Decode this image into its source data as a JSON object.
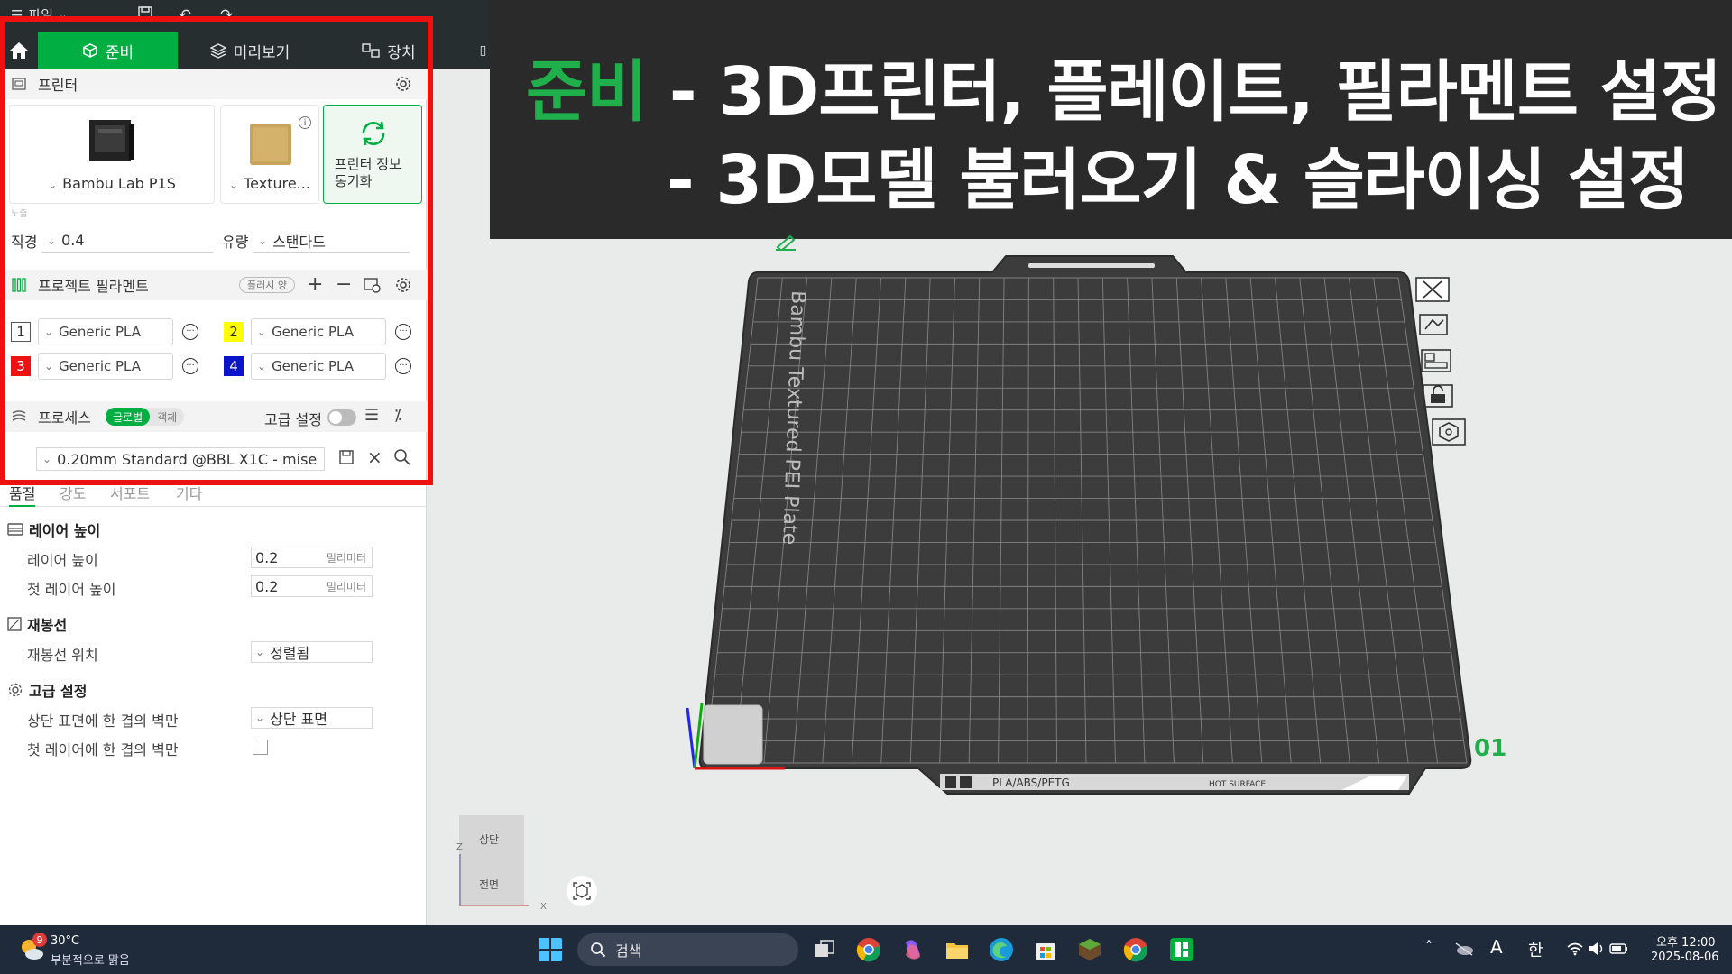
{
  "menu": {
    "file_label": "파일"
  },
  "tabs": [
    {
      "label": "준비"
    },
    {
      "label": "미리보기"
    },
    {
      "label": "장치"
    }
  ],
  "printer": {
    "section_title": "프린터",
    "printer_name": "Bambu Lab P1S",
    "plate_name": "Texture...",
    "sync_label_1": "프린터 정보",
    "sync_label_2": "동기화",
    "nozzle_section": "노즐",
    "diameter_label": "직경",
    "diameter_value": "0.4",
    "flow_label": "유량",
    "flow_value": "스탠다드"
  },
  "filament": {
    "section_title": "프로젝트 필라멘트",
    "flush_label": "플러시 양",
    "items": [
      {
        "num": "1",
        "name": "Generic PLA",
        "color": "#ffffff"
      },
      {
        "num": "2",
        "name": "Generic PLA",
        "color": "#ffff00"
      },
      {
        "num": "3",
        "name": "Generic PLA",
        "color": "#ee1111"
      },
      {
        "num": "4",
        "name": "Generic PLA",
        "color": "#0a14c8"
      }
    ]
  },
  "process": {
    "section_title": "프로세스",
    "global_label": "글로벌",
    "object_label": "객체",
    "advanced_label": "고급 설정",
    "preset": "0.20mm Standard @BBL X1C - mise"
  },
  "subtabs": [
    "품질",
    "강도",
    "서포트",
    "기타"
  ],
  "quality": {
    "layer_group": "레이어 높이",
    "layer_height_label": "레이어 높이",
    "layer_height_value": "0.2",
    "first_layer_label": "첫 레이어 높이",
    "first_layer_value": "0.2",
    "unit": "밀리미터",
    "seam_group": "재봉선",
    "seam_pos_label": "재봉선 위치",
    "seam_pos_value": "정렬됨",
    "adv_group": "고급 설정",
    "top_wall_label": "상단 표면에 한 겹의 벽만",
    "top_wall_value": "상단 표면",
    "first_wall_label": "첫 레이어에 한 겹의 벽만"
  },
  "banner": {
    "line1_green": "준비",
    "line1_rest": " - 3D프린터, 플레이트, 필라멘트 설정",
    "line2": "- 3D모델 불러오기 & 슬라이싱 설정"
  },
  "plate": {
    "bed_text": "Bambu Textured PEI Plate",
    "material_text": "PLA/ABS/PETG",
    "hot_text": "HOT SURFACE",
    "plate_number": "01"
  },
  "viewcube": {
    "top": "상단",
    "front": "전면",
    "axis_z": "Z",
    "axis_x": "X"
  },
  "taskbar": {
    "weather_temp": "30°C",
    "weather_desc": "부분적으로 맑음",
    "weather_badge": "9",
    "search_label": "검색",
    "ime_a": "A",
    "ime_han": "한",
    "time": "오후 12:00",
    "date": "2025-08-06"
  },
  "colors": {
    "accent": "#00ae42",
    "highlight": "#ee1111",
    "banner_bg": "#2a2a2a"
  }
}
